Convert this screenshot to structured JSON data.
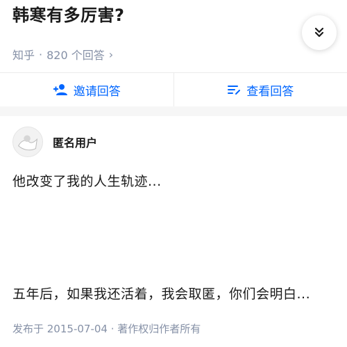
{
  "question": {
    "title": "韩寒有多厉害?",
    "source": "知乎",
    "separator": "·",
    "answer_count": "820 个回答",
    "meta_chevron": "›"
  },
  "actions": {
    "invite_label": "邀请回答",
    "view_label": "查看回答"
  },
  "answer": {
    "author": "匿名用户",
    "paragraphs": [
      "他改变了我的人生轨迹...",
      "五年后，如果我还活着，我会取匿，你们会明白..."
    ],
    "footer": "发布于 2015-07-04 · 著作权归作者所有"
  },
  "colors": {
    "accent": "#0066ff",
    "meta": "#8590a6",
    "text": "#1a1a1a"
  },
  "icons": {
    "collapse": "double-chevron-down-icon",
    "invite": "add-person-icon",
    "view": "list-icon",
    "avatar": "anonymous-avatar-icon"
  }
}
